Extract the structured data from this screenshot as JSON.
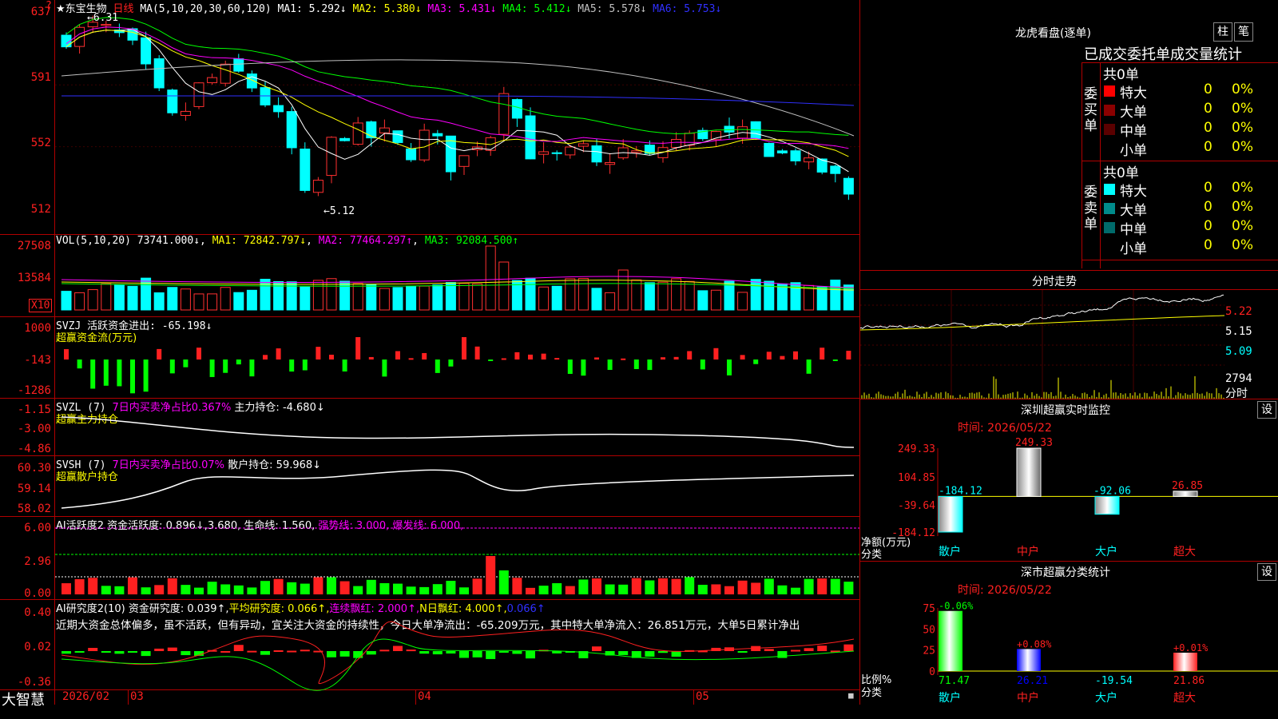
{
  "stock": {
    "title": "★东宝生物",
    "period": "日线",
    "ma_params": "MA(5,10,20,30,60,120)"
  },
  "ma": [
    {
      "label": "MA1: 5.292↓",
      "color": "#ffffff"
    },
    {
      "label": "MA2: 5.380↓",
      "color": "#ffff00"
    },
    {
      "label": "MA3: 5.431↓",
      "color": "#ff00ff"
    },
    {
      "label": "MA4: 5.412↓",
      "color": "#00ff00"
    },
    {
      "label": "MA5: 5.578↓",
      "color": "#c0c0c0"
    },
    {
      "label": "MA6: 5.753↓",
      "color": "#3030ff"
    }
  ],
  "price_axis": [
    "637",
    "591",
    "552",
    "512"
  ],
  "price_high": "←6.31",
  "price_low": "←5.12",
  "vol": {
    "header": "VOL(5,10,20)",
    "value": "73741.000↓",
    "ma1": "MA1: 72842.797↓",
    "ma2": "MA2: 77464.297↑",
    "ma3": "MA3: 92084.500↑",
    "axis": [
      "27508",
      "13584"
    ],
    "unit": "X10"
  },
  "svzj": {
    "header": "SVZJ  活跃资金进出: -65.198↓",
    "sub": "超赢资金流(万元)",
    "axis": [
      "1000",
      "-143",
      "-1286"
    ]
  },
  "svzl": {
    "header": "SVZL (7) ",
    "h2": "7日内买卖净占比0.367%",
    "h3": " 主力持仓: -4.680↓",
    "sub": "超赢主力持仓",
    "axis": [
      "-1.15",
      "-3.00",
      "-4.86"
    ]
  },
  "svsh": {
    "header": "SVSH (7) ",
    "h2": "7日内买卖净占比0.07%",
    "h3": " 散户持仓: 59.968↓",
    "sub": "超赢散户持仓",
    "axis": [
      "60.30",
      "59.14",
      "58.02"
    ]
  },
  "ai1": {
    "header": "AI活跃度2 资金活跃度: 0.896↓,3.680, 生命线: 1.560,",
    "h2": " 强势线: 3.000, 爆发线: 6.000,",
    "axis": [
      "6.00",
      "2.96",
      "0.00"
    ]
  },
  "ai2": {
    "header": "AI研究度2(10) 资金研究度: 0.039↑,",
    "h2": "平均研究度: 0.066↑,",
    "h3": "连续飘红: 2.000↑,",
    "h4": "N日飘红: 4.000↑,",
    "h5": "0.066↑",
    "axis": [
      "0.40",
      "0.02",
      "-0.36"
    ]
  },
  "comment": "近期大资金总体偏多，虽不活跃，但有异动，宜关注大资金的持续性，今日大单净流出：-65.209万元，其中特大单净流入：26.851万元，大单5日累计净出",
  "bottom": {
    "brand": "大智慧",
    "dates": [
      "2026/02",
      "03",
      "04",
      "05"
    ]
  },
  "dragon": {
    "title": "龙虎看盘(逐单)",
    "btn_column": "柱",
    "btn_pen": "笔",
    "headline": "已成交委托单成交量统计",
    "buy_label": "委买单",
    "sell_label": "委卖单",
    "buy_total": "共0单",
    "sell_total": "共0单",
    "buy_rows": [
      {
        "name": "特大",
        "count": "0",
        "pct": "0%",
        "color": "#ff0000"
      },
      {
        "name": "大单",
        "count": "0",
        "pct": "0%",
        "color": "#8b0000"
      },
      {
        "name": "中单",
        "count": "0",
        "pct": "0%",
        "color": "#5a0000"
      },
      {
        "name": "小单",
        "count": "0",
        "pct": "0%",
        "color": "#000"
      }
    ],
    "sell_rows": [
      {
        "name": "特大",
        "count": "0",
        "pct": "0%",
        "color": "#00ffff"
      },
      {
        "name": "大单",
        "count": "0",
        "pct": "0%",
        "color": "#008b8b"
      },
      {
        "name": "中单",
        "count": "0",
        "pct": "0%",
        "color": "#006b6b"
      },
      {
        "name": "小单",
        "count": "0",
        "pct": "0%",
        "color": "#000"
      }
    ]
  },
  "intraday": {
    "title": "分时走势",
    "axis": [
      "5.22",
      "5.15",
      "5.09"
    ],
    "vol": "2794",
    "vol_label": "分时"
  },
  "sz_monitor": {
    "title": "深圳超赢实时监控",
    "btn": "设",
    "time": "时间: 2026/05/22",
    "axis": [
      "249.33",
      "104.85",
      "-39.64",
      "-184.12"
    ],
    "ylabel": "净额(万元)",
    "xlabel": "分类",
    "chart_data": {
      "type": "bar",
      "categories": [
        "散户",
        "中户",
        "大户",
        "超大"
      ],
      "values": [
        -184.12,
        249.33,
        -92.06,
        26.85
      ],
      "labels": [
        "-184.12",
        "249.33",
        "-92.06",
        "26.85"
      ],
      "ylim": [
        -184.12,
        249.33
      ]
    }
  },
  "sz_class": {
    "title": "深市超赢分类统计",
    "btn": "设",
    "time": "时间: 2026/05/22",
    "axis": [
      "75",
      "50",
      "25",
      "0"
    ],
    "ylabel": "比例%",
    "xlabel": "分类",
    "chart_data": {
      "type": "bar",
      "categories": [
        "散户",
        "中户",
        "大户",
        "超大"
      ],
      "values": [
        71.47,
        26.21,
        -19.54,
        21.86
      ],
      "tops": [
        "-0.06%",
        "+0.08%",
        "",
        "+0.01%"
      ],
      "ylim": [
        0,
        75
      ]
    }
  }
}
